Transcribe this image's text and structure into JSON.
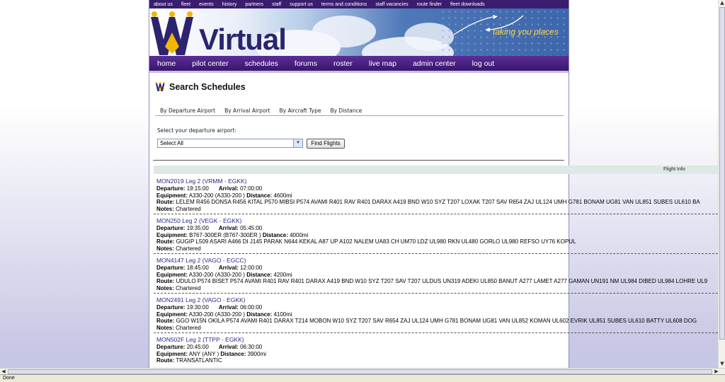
{
  "top_links": [
    "about us",
    "fleet",
    "events",
    "history",
    "partners",
    "staff",
    "support us",
    "terms and conditions",
    "staff vacancies",
    "route finder",
    "fleet downloads"
  ],
  "brand": {
    "logo_text": "Virtual",
    "tagline": "taking you places",
    "colors": {
      "purple": "#3a1d6e",
      "logo_blue": "#2c2470",
      "gold": "#f2b705",
      "tagline": "#ffd43b"
    }
  },
  "main_nav": [
    "home",
    "pilot center",
    "schedules",
    "forums",
    "roster",
    "live map",
    "admin center",
    "log out"
  ],
  "page": {
    "title": "Search Schedules"
  },
  "tabs": [
    "By Departure Airport",
    "By Arrival Airport",
    "By Aircraft Type",
    "By Distance"
  ],
  "search": {
    "label": "Select your departure airport:",
    "selected": "Select All",
    "button": "Find Flights"
  },
  "results_header": "Flight Info",
  "labels": {
    "departure": "Departure:",
    "arrival": "Arrival:",
    "equipment": "Equipment:",
    "distance": "Distance:",
    "route": "Route:",
    "notes": "Notes:"
  },
  "flights": [
    {
      "id": "MON2019 Leg 2 (VRMM - EGKK)",
      "departure": "19:15:00",
      "arrival": "07:00:00",
      "equipment": "A330-200 (A330-200 )",
      "distance": "4600mi",
      "route": "LELEM R456 DONSA R456 KITAL P570 MIBSI P574 AVAMI R401 RAV R401 DARAX A419 BND W10 SYZ T207 LOXAK T207 SAV R654 ZAJ UL124 UMH G781 BONAM UG81 VAN UL851 SUBES UL610 BA",
      "notes": "Chartered"
    },
    {
      "id": "MON250 Leg 2 (VEGK - EGKK)",
      "departure": "19:35:00",
      "arrival": "05:45:00",
      "equipment": "B767-300ER (B767-300ER )",
      "distance": "4000mi",
      "route": "GUGIP L509 ASARI A466 DI J145 PARAK N644 KEKAL A87 UP A102 NALEM UA83 CH UM70 LDZ UL980 RKN UL480 GORLO UL980 REFSO UY76 KOPUL",
      "notes": "Chartered"
    },
    {
      "id": "MON4147 Leg 2 (VAGO - EGCC)",
      "departure": "18:45:00",
      "arrival": "12:00:00",
      "equipment": "A330-200 (A330-200 )",
      "distance": "4200mi",
      "route": "UDULO P574 BISET P574 AVAMI R401 RAV R401 DARAX A419 BND W10 SYZ T207 SAV T207 ULDUS UN319 ADEKI UL850 BANUT A277 LAMET A277 GAMAN UN191 NM UL984 DIBED UL984 LOHRE UL9",
      "notes": "Chartered"
    },
    {
      "id": "MON2491 Leg 2 (VAGO - EGKK)",
      "departure": "19:30:00",
      "arrival": "06:00:00",
      "equipment": "A330-200 (A330-200 )",
      "distance": "4100mi",
      "route": "GGO W15N OKILA P574 AVAMI R401 DARAX T214 MOBON W10 SYZ T207 SAV R654 ZAJ UL124 UMH G781 BONAM UG81 VAN UL852 KOMAN UL602 EVRIK UL851 SUBES UL610 BATTY UL608 DOG",
      "notes": "Chartered"
    },
    {
      "id": "MON502F Leg 2 (TTPP - EGKK)",
      "departure": "20:45:00",
      "arrival": "06:30:00",
      "equipment": "ANY (ANY )",
      "distance": "3900mi",
      "route": "TRANSATLANTIC",
      "notes": ""
    }
  ],
  "status": {
    "text": "Done"
  }
}
